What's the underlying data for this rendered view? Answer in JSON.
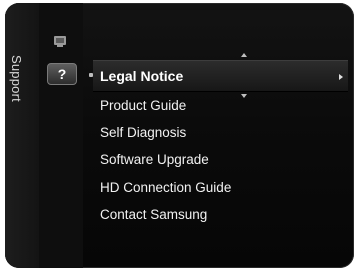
{
  "sidebar": {
    "title": "Support"
  },
  "icons": {
    "small": "settings-small-icon",
    "help": "help-question-icon",
    "help_glyph": "?"
  },
  "menu": {
    "selected": {
      "label": "Legal Notice"
    },
    "items": [
      {
        "label": "Product Guide"
      },
      {
        "label": "Self Diagnosis"
      },
      {
        "label": "Software Upgrade"
      },
      {
        "label": "HD Connection Guide"
      },
      {
        "label": "Contact Samsung"
      }
    ]
  }
}
